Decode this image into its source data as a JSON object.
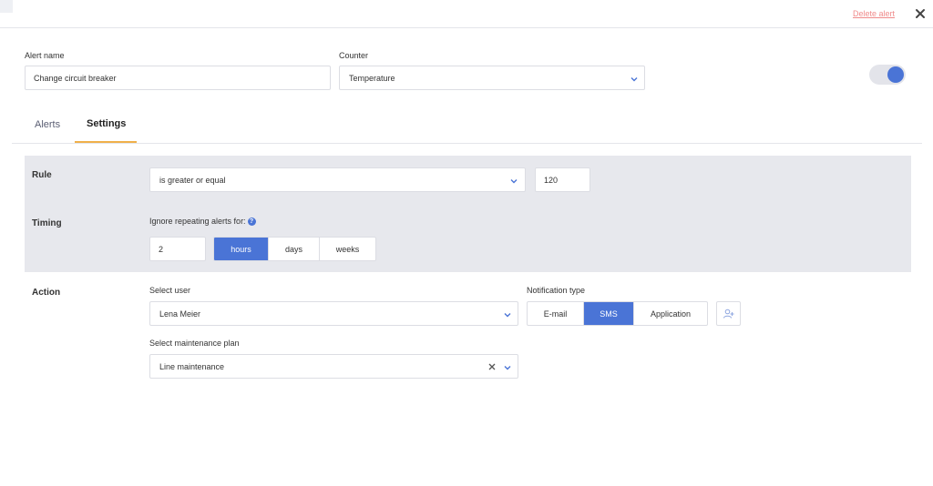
{
  "header": {
    "delete_label": "Delete alert"
  },
  "alert": {
    "name_label": "Alert name",
    "name_value": "Change circuit breaker",
    "counter_label": "Counter",
    "counter_value": "Temperature",
    "enabled": true
  },
  "tabs": [
    {
      "label": "Alerts",
      "active": false
    },
    {
      "label": "Settings",
      "active": true
    }
  ],
  "rule": {
    "title": "Rule",
    "condition": "is greater or equal",
    "threshold": "120"
  },
  "timing": {
    "title": "Timing",
    "ignore_label": "Ignore repeating alerts for:",
    "help_glyph": "?",
    "amount": "2",
    "units": [
      {
        "label": "hours",
        "active": true
      },
      {
        "label": "days",
        "active": false
      },
      {
        "label": "weeks",
        "active": false
      }
    ]
  },
  "action": {
    "title": "Action",
    "user_label": "Select user",
    "user_value": "Lena Meier",
    "notification_label": "Notification type",
    "notification_types": [
      {
        "label": "E-mail",
        "active": false
      },
      {
        "label": "SMS",
        "active": true
      },
      {
        "label": "Application",
        "active": false
      }
    ],
    "plan_label": "Select maintenance plan",
    "plan_value": "Line maintenance"
  },
  "colors": {
    "accent": "#4a74d6",
    "danger_link": "#f08b8b",
    "tab_underline": "#f0b04a",
    "panel_bg": "#e7e8ed"
  }
}
